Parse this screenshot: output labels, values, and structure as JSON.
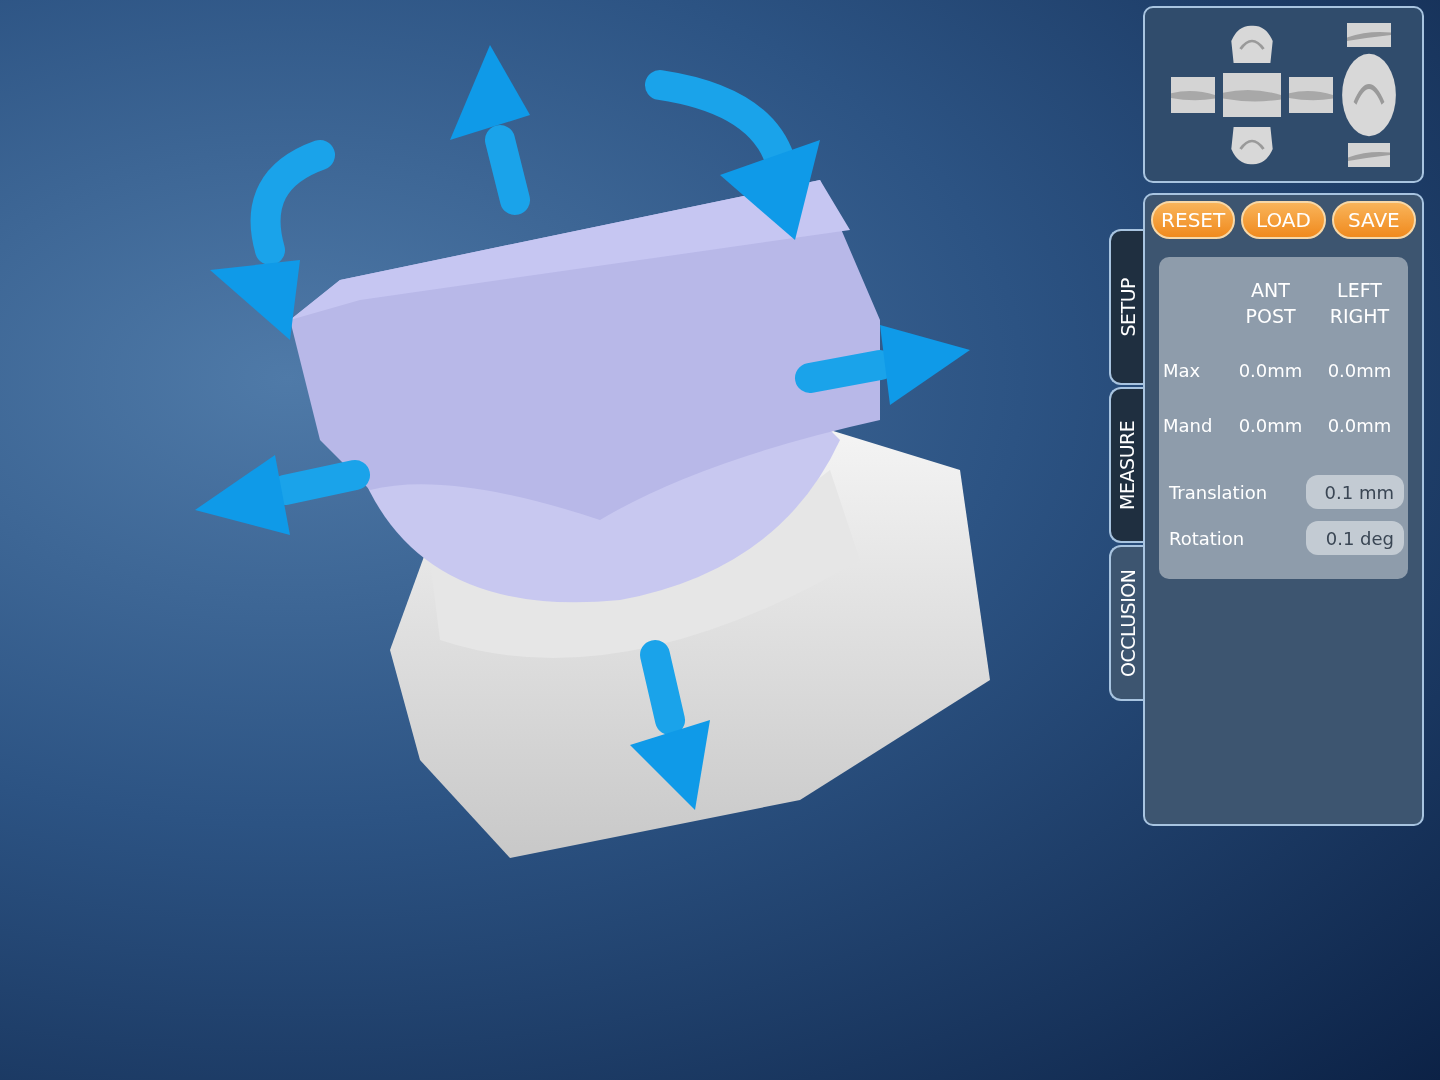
{
  "toolbar_buttons": [
    "RESET",
    "LOAD",
    "SAVE"
  ],
  "tabs": [
    {
      "label": "SETUP",
      "selected": false
    },
    {
      "label": "MEASURE",
      "selected": false
    },
    {
      "label": "OCCLUSION",
      "selected": true
    }
  ],
  "measure_table": {
    "columns": [
      [
        "ANT",
        "POST"
      ],
      [
        "LEFT",
        "RIGHT"
      ]
    ],
    "rows": [
      {
        "label": "Max",
        "values": [
          "0.0mm",
          "0.0mm"
        ]
      },
      {
        "label": "Mand",
        "values": [
          "0.0mm",
          "0.0mm"
        ]
      }
    ]
  },
  "steps": [
    {
      "label": "Translation",
      "value": "0.1 mm"
    },
    {
      "label": "Rotation",
      "value": "0.1 deg"
    }
  ]
}
